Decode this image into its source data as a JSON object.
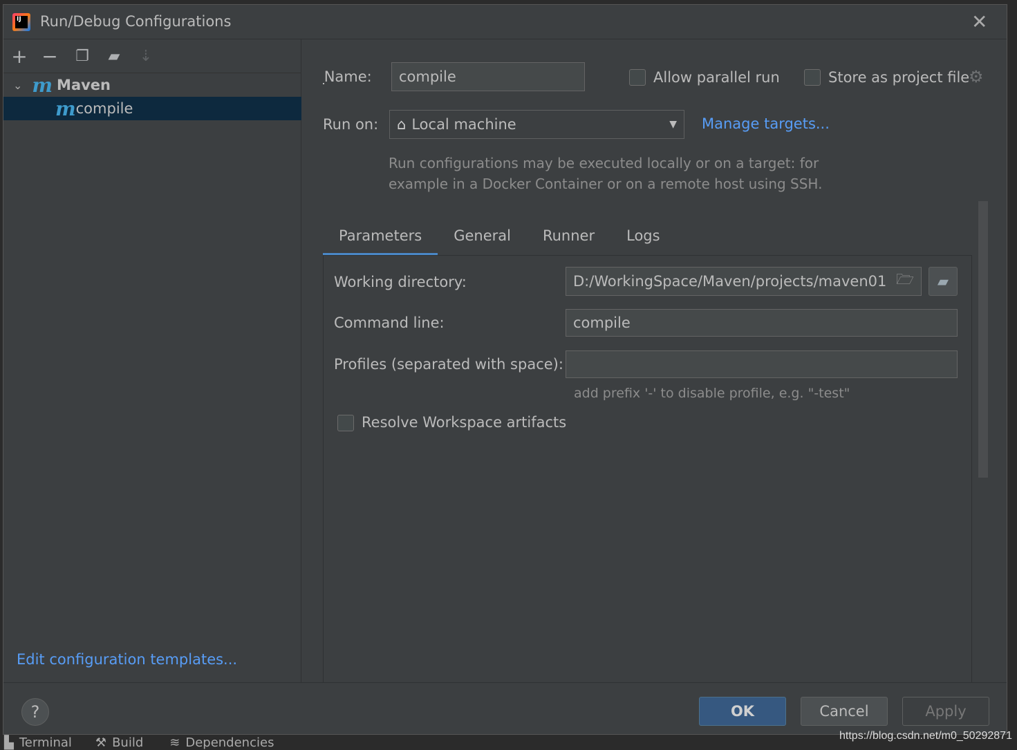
{
  "title": "Run/Debug Configurations",
  "toolbar": {
    "add": "+",
    "remove": "−",
    "copy": "copy-icon",
    "folder": "new-folder-icon",
    "sort": "sort-icon"
  },
  "tree": {
    "group": "Maven",
    "item": "compile"
  },
  "edit_templates": "Edit configuration templates...",
  "name_label": "Name:",
  "name_value": "compile",
  "allow_parallel": "Allow parallel run",
  "store_project": "Store as project file",
  "run_on_label": "Run on:",
  "run_on_value": "Local machine",
  "manage_targets": "Manage targets...",
  "hint": "Run configurations may be executed locally or on a target: for example in a Docker Container or on a remote host using SSH.",
  "tabs": [
    "Parameters",
    "General",
    "Runner",
    "Logs"
  ],
  "active_tab": "Parameters",
  "params": {
    "wd_label": "Working directory:",
    "wd_value": "D:/WorkingSpace/Maven/projects/maven01",
    "cmd_label": "Command line:",
    "cmd_value": "compile",
    "profiles_label": "Profiles (separated with space):",
    "profiles_value": "",
    "profiles_hint": "add prefix '-' to disable profile, e.g. \"-test\"",
    "resolve": "Resolve Workspace artifacts"
  },
  "buttons": {
    "help": "?",
    "ok": "OK",
    "cancel": "Cancel",
    "apply": "Apply"
  },
  "statusbar": [
    "Terminal",
    "Build",
    "Dependencies"
  ],
  "watermark": "https://blog.csdn.net/m0_50292871"
}
